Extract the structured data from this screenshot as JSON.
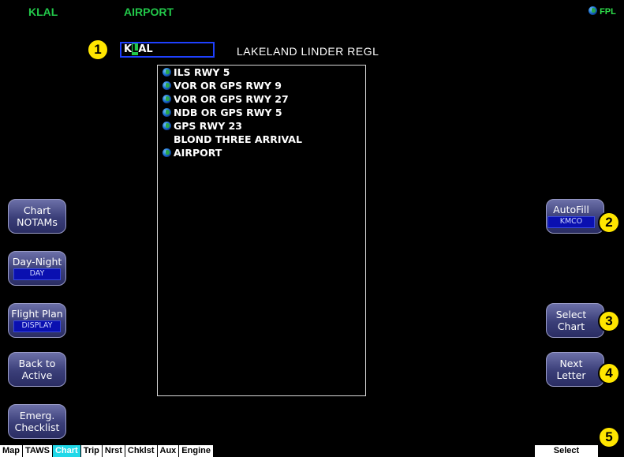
{
  "header": {
    "ident": "KLAL",
    "page_title": "AIRPORT",
    "fpl_label": "FPL"
  },
  "identifier_field": {
    "value_before_cursor": "K",
    "cursor_char": "L",
    "value_after_cursor": "AL"
  },
  "airport_name": "LAKELAND LINDER REGL",
  "chart_list": [
    {
      "label": "ILS RWY 5",
      "icon": "globe-icon"
    },
    {
      "label": "VOR OR GPS RWY 9",
      "icon": "globe-icon"
    },
    {
      "label": "VOR OR GPS RWY 27",
      "icon": "globe-icon"
    },
    {
      "label": "NDB OR GPS RWY 5",
      "icon": "globe-icon"
    },
    {
      "label": "GPS RWY 23",
      "icon": "globe-icon"
    },
    {
      "label": "BLOND THREE ARRIVAL",
      "icon": ""
    },
    {
      "label": "AIRPORT",
      "icon": "globe-icon"
    }
  ],
  "left_keys": [
    {
      "line1": "Chart",
      "line2": "NOTAMs",
      "sub": ""
    },
    {
      "line1": "Day-Night",
      "line2": "",
      "sub": "DAY"
    },
    {
      "line1": "Flight Plan",
      "line2": "",
      "sub": "DISPLAY"
    },
    {
      "line1": "Back to",
      "line2": "Active",
      "sub": ""
    },
    {
      "line1": "Emerg.",
      "line2": "Checklist",
      "sub": ""
    }
  ],
  "right_keys": [
    {
      "line1": "AutoFill",
      "line2": "",
      "sub": "KMCO"
    },
    {
      "line1": "Select",
      "line2": "Chart",
      "sub": ""
    },
    {
      "line1": "Next",
      "line2": "Letter",
      "sub": ""
    }
  ],
  "callouts": [
    "1",
    "2",
    "3",
    "4",
    "5"
  ],
  "tabs": [
    {
      "label": "Map",
      "active": false
    },
    {
      "label": "TAWS",
      "active": false
    },
    {
      "label": "Chart",
      "active": true
    },
    {
      "label": "Trip",
      "active": false
    },
    {
      "label": "Nrst",
      "active": false
    },
    {
      "label": "Chklst",
      "active": false
    },
    {
      "label": "Aux",
      "active": false
    },
    {
      "label": "Engine",
      "active": false
    }
  ],
  "select_label": "Select",
  "colors": {
    "background": "#000000",
    "header_green": "#22c84a",
    "active_tab": "#20d8e8",
    "callout": "#ffe600"
  }
}
